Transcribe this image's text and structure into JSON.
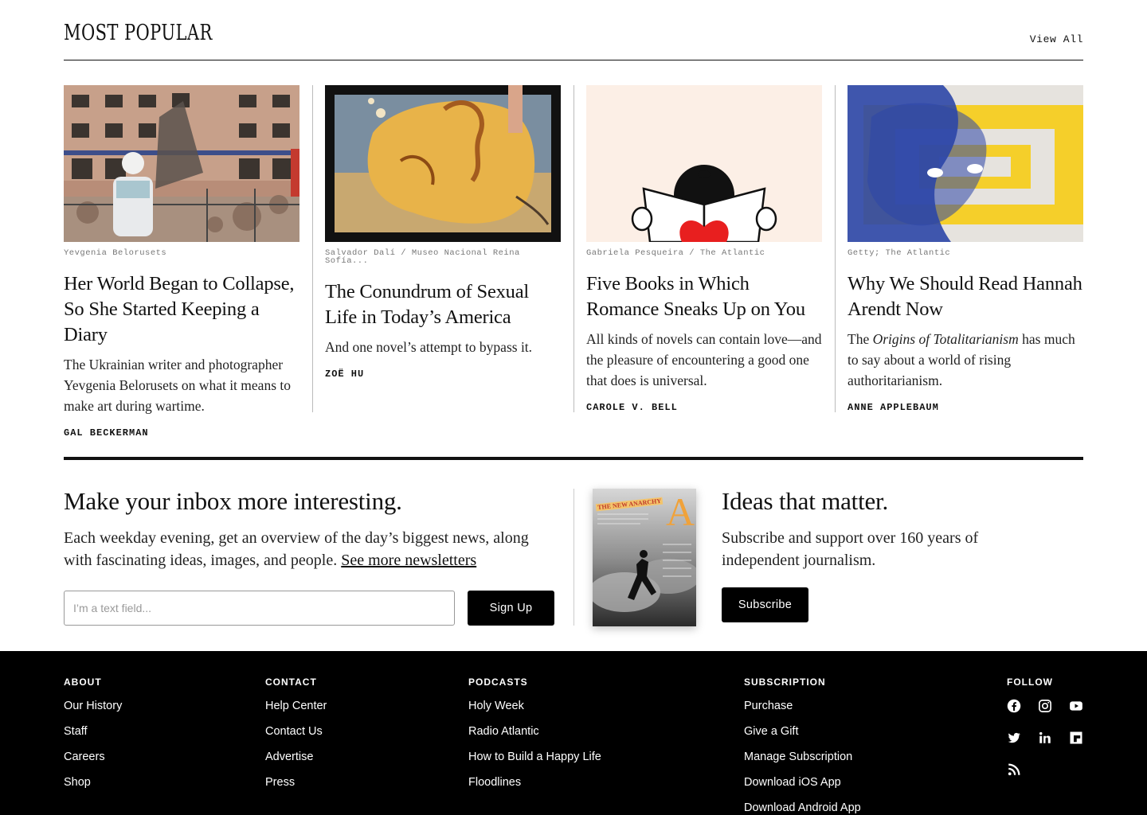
{
  "most_popular": {
    "title": "MOST POPULAR",
    "view_all": "View All",
    "articles": [
      {
        "credit": "Yevgenia Belorusets",
        "headline": "Her World Began to Collapse, So She Started Keeping a Diary",
        "dek": "The Ukrainian writer and photographer Yevgenia Belorusets on what it means to make art during wartime.",
        "byline": "GAL BECKERMAN"
      },
      {
        "credit": "Salvador Dalí / Museo Nacional Reina Sofía...",
        "headline": "The Conundrum of Sexual Life in Today’s America",
        "dek": "And one novel’s attempt to bypass it.",
        "byline": "ZOË HU"
      },
      {
        "credit": "Gabriela Pesqueira / The Atlantic",
        "headline": "Five Books in Which Romance Sneaks Up on You",
        "dek": "All kinds of novels can contain love—and the pleasure of encountering a good one that does is universal.",
        "byline": "CAROLE V. BELL"
      },
      {
        "credit": "Getty; The Atlantic",
        "headline": "Why We Should Read Hannah Arendt Now",
        "dek_prefix": "The ",
        "dek_italic": "Origins of Totalitarianism",
        "dek_suffix": " has much to say about a world of rising authoritarianism.",
        "byline": "ANNE APPLEBAUM"
      }
    ]
  },
  "newsletter": {
    "heading": "Make your inbox more interesting.",
    "body": "Each weekday evening, get an overview of the day’s biggest news, along with fascinating ideas, images, and people. ",
    "link": "See more newsletters",
    "input_placeholder": "I’m a text field...",
    "button": "Sign Up"
  },
  "subscribe": {
    "magazine_cover_title": "THE NEW ANARCHY",
    "magazine_cover_letter": "A",
    "heading": "Ideas that matter.",
    "body": "Subscribe and support over 160 years of independent journalism.",
    "button": "Subscribe"
  },
  "footer": {
    "about": {
      "heading": "ABOUT",
      "links": [
        "Our History",
        "Staff",
        "Careers",
        "Shop"
      ]
    },
    "contact": {
      "heading": "CONTACT",
      "links": [
        "Help Center",
        "Contact Us",
        "Advertise",
        "Press"
      ]
    },
    "podcasts": {
      "heading": "PODCASTS",
      "links": [
        "Holy Week",
        "Radio Atlantic",
        "How to Build a Happy Life",
        "Floodlines"
      ]
    },
    "subscription": {
      "heading": "SUBSCRIPTION",
      "links": [
        "Purchase",
        "Give a Gift",
        "Manage Subscription",
        "Download iOS App",
        "Download Android App"
      ]
    },
    "follow": {
      "heading": "FOLLOW",
      "icons": [
        "facebook-icon",
        "instagram-icon",
        "youtube-icon",
        "twitter-icon",
        "linkedin-icon",
        "flipboard-icon",
        "rss-icon"
      ]
    }
  }
}
